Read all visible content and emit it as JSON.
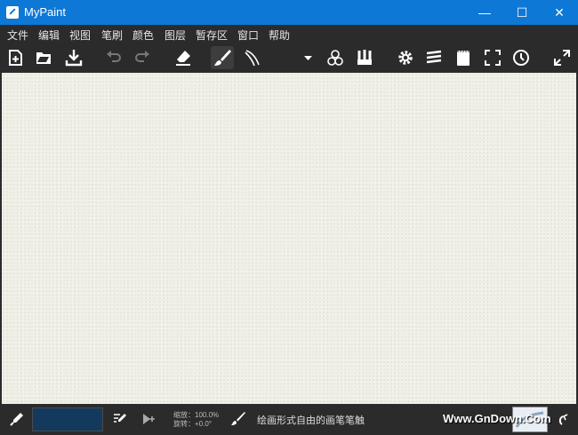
{
  "window": {
    "title": "MyPaint",
    "minimize": "—",
    "maximize": "☐",
    "close": "✕"
  },
  "menu": [
    "文件",
    "编辑",
    "视图",
    "笔刷",
    "颜色",
    "图层",
    "暂存区",
    "窗口",
    "帮助"
  ],
  "toolbar": {
    "buttons": [
      "new-icon",
      "open-icon",
      "save-icon",
      "undo-icon",
      "redo-icon",
      "eraser-icon",
      "brush-icon",
      "brush-alt-icon",
      "dropdown-arrow-icon",
      "color-circles-icon",
      "brushes-icon",
      "settings-icon",
      "layers-icon",
      "scratchpad-icon",
      "fullscreen-icon",
      "history-icon",
      "expand-icon"
    ],
    "active": "brush-icon"
  },
  "status": {
    "zoom_label": "缩放：100.0%",
    "rotate_label": "旋转：+0.0°",
    "brush_description": "绘画形式自由的画笔笔触",
    "watermark": "Www.GnDown.Com",
    "current_color": "#133a5c"
  },
  "colors": {
    "titlebar": "#0e78d7",
    "chrome": "#2b2b2b",
    "canvas": "#efefe6"
  }
}
